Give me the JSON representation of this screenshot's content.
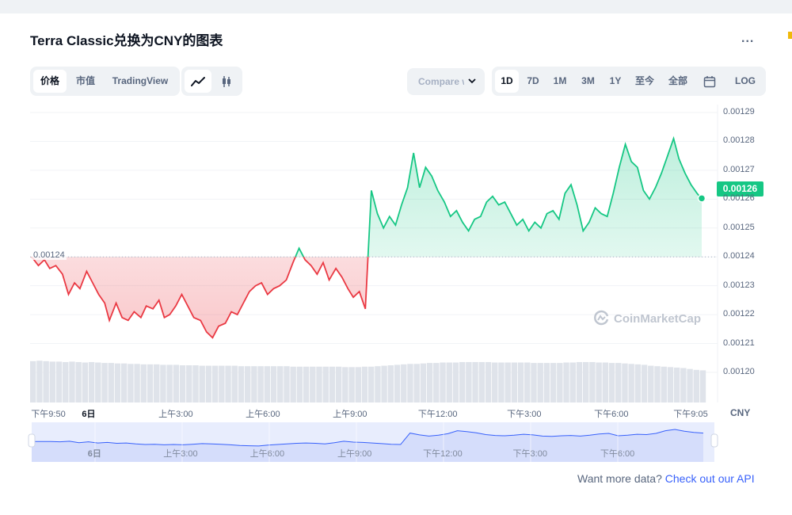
{
  "title": "Terra Classic兑换为CNY的图表",
  "more_label": "...",
  "view_tabs": [
    {
      "label": "价格",
      "active": true
    },
    {
      "label": "市值",
      "active": false
    },
    {
      "label": "TradingView",
      "active": false
    }
  ],
  "chart_type_icons": [
    "line-chart-icon",
    "candlestick-icon"
  ],
  "compare_label": "Compare with",
  "range_tabs": [
    {
      "label": "1D",
      "active": true
    },
    {
      "label": "7D",
      "active": false
    },
    {
      "label": "1M",
      "active": false
    },
    {
      "label": "3M",
      "active": false
    },
    {
      "label": "1Y",
      "active": false
    },
    {
      "label": "至今",
      "active": false
    },
    {
      "label": "全部",
      "active": false
    }
  ],
  "calendar_icon": "calendar-icon",
  "log_label": "LOG",
  "currency": "CNY",
  "watermark": "CoinMarketCap",
  "footer": {
    "text": "Want more data? ",
    "link": "Check out our API"
  },
  "colors": {
    "up": "#16c784",
    "down": "#ea3943",
    "accent": "#3861fb"
  },
  "chart_data": {
    "type": "line",
    "reference_value": 0.00124,
    "reference_label": "0.00124",
    "current_value": 0.00126,
    "current_label": "0.00126",
    "y_ticks": [
      "0.00129",
      "0.00128",
      "0.00127",
      "0.00126",
      "0.00125",
      "0.00124",
      "0.00123",
      "0.00122",
      "0.00121",
      "0.00120"
    ],
    "ylim": [
      0.001195,
      0.00129
    ],
    "x_ticks": [
      {
        "label": "下午9:50",
        "pos": 0.0,
        "bold": false
      },
      {
        "label": "6日",
        "pos": 0.085,
        "bold": true
      },
      {
        "label": "上午3:00",
        "pos": 0.215,
        "bold": false
      },
      {
        "label": "上午6:00",
        "pos": 0.345,
        "bold": false
      },
      {
        "label": "上午9:00",
        "pos": 0.475,
        "bold": false
      },
      {
        "label": "下午12:00",
        "pos": 0.606,
        "bold": false
      },
      {
        "label": "下午3:00",
        "pos": 0.735,
        "bold": false
      },
      {
        "label": "下午6:00",
        "pos": 0.865,
        "bold": false
      },
      {
        "label": "下午9:05",
        "pos": 0.985,
        "bold": false
      }
    ],
    "nav_ticks": [
      {
        "label": "6日",
        "pos": 0.092,
        "bold": true
      },
      {
        "label": "上午3:00",
        "pos": 0.218,
        "bold": false
      },
      {
        "label": "上午6:00",
        "pos": 0.345,
        "bold": false
      },
      {
        "label": "上午9:00",
        "pos": 0.473,
        "bold": false
      },
      {
        "label": "下午12:00",
        "pos": 0.602,
        "bold": false
      },
      {
        "label": "下午3:00",
        "pos": 0.73,
        "bold": false
      },
      {
        "label": "下午6:00",
        "pos": 0.858,
        "bold": false
      }
    ],
    "series": [
      {
        "x": [
          0.0,
          0.01,
          0.019,
          0.027,
          0.036,
          0.046,
          0.055,
          0.064,
          0.072,
          0.082,
          0.091,
          0.1,
          0.109,
          0.116,
          0.126,
          0.135,
          0.144,
          0.153,
          0.163,
          0.171,
          0.181,
          0.19,
          0.198,
          0.206,
          0.215,
          0.224,
          0.233,
          0.242,
          0.252,
          0.261,
          0.27,
          0.279,
          0.289,
          0.298,
          0.307,
          0.316,
          0.325,
          0.334,
          0.343,
          0.352,
          0.361,
          0.37,
          0.38,
          0.39,
          0.399,
          0.408,
          0.417,
          0.426,
          0.435,
          0.444,
          0.454,
          0.463,
          0.472,
          0.48,
          0.489,
          0.498,
          0.507,
          0.516,
          0.525,
          0.534,
          0.543,
          0.552,
          0.561,
          0.57,
          0.579,
          0.588,
          0.597,
          0.606,
          0.616,
          0.625,
          0.634,
          0.643,
          0.652,
          0.661,
          0.67,
          0.679,
          0.688,
          0.697,
          0.706,
          0.715,
          0.724,
          0.733,
          0.742,
          0.751,
          0.76,
          0.769,
          0.778,
          0.787,
          0.796,
          0.805,
          0.814,
          0.823,
          0.832,
          0.841,
          0.85,
          0.859,
          0.868,
          0.877,
          0.886,
          0.895,
          0.904,
          0.913,
          0.922,
          0.931,
          0.94,
          0.949,
          0.958,
          0.966,
          0.975,
          0.984,
          0.993,
          1.0
        ],
        "y": [
          0.00124,
          0.001237,
          0.001239,
          0.001236,
          0.001237,
          0.001234,
          0.001227,
          0.001231,
          0.001229,
          0.001235,
          0.001231,
          0.001227,
          0.001224,
          0.001218,
          0.001224,
          0.001219,
          0.001218,
          0.001221,
          0.001219,
          0.001223,
          0.001222,
          0.001225,
          0.001219,
          0.00122,
          0.001223,
          0.001227,
          0.001223,
          0.001219,
          0.001218,
          0.001214,
          0.001212,
          0.001216,
          0.001217,
          0.001221,
          0.00122,
          0.001224,
          0.001228,
          0.00123,
          0.001231,
          0.001227,
          0.001229,
          0.00123,
          0.001232,
          0.001238,
          0.001243,
          0.001239,
          0.001237,
          0.001234,
          0.001238,
          0.001232,
          0.001236,
          0.001233,
          0.001229,
          0.001226,
          0.001228,
          0.001222,
          0.001263,
          0.001255,
          0.00125,
          0.001254,
          0.001251,
          0.001258,
          0.001264,
          0.001276,
          0.001264,
          0.001271,
          0.001268,
          0.001263,
          0.001259,
          0.001254,
          0.001256,
          0.001252,
          0.001249,
          0.001253,
          0.001254,
          0.001259,
          0.001261,
          0.001258,
          0.001259,
          0.001255,
          0.001251,
          0.001253,
          0.001249,
          0.001252,
          0.00125,
          0.001255,
          0.001256,
          0.001253,
          0.001262,
          0.001265,
          0.001258,
          0.001249,
          0.001252,
          0.001257,
          0.001255,
          0.001254,
          0.001262,
          0.001271,
          0.001279,
          0.001273,
          0.001271,
          0.001263,
          0.00126,
          0.001264,
          0.001269,
          0.001275,
          0.001281,
          0.001274,
          0.001269,
          0.001265,
          0.001262,
          0.00126
        ]
      }
    ],
    "volume": [
      0.9,
      0.91,
      0.9,
      0.89,
      0.89,
      0.88,
      0.89,
      0.88,
      0.87,
      0.88,
      0.87,
      0.86,
      0.86,
      0.85,
      0.85,
      0.84,
      0.84,
      0.83,
      0.83,
      0.83,
      0.82,
      0.82,
      0.82,
      0.81,
      0.81,
      0.81,
      0.8,
      0.8,
      0.8,
      0.8,
      0.8,
      0.8,
      0.79,
      0.79,
      0.79,
      0.79,
      0.79,
      0.79,
      0.79,
      0.79,
      0.78,
      0.78,
      0.78,
      0.78,
      0.78,
      0.78,
      0.78,
      0.78,
      0.77,
      0.77,
      0.77,
      0.78,
      0.78,
      0.79,
      0.8,
      0.81,
      0.82,
      0.83,
      0.84,
      0.84,
      0.85,
      0.86,
      0.86,
      0.87,
      0.87,
      0.87,
      0.88,
      0.88,
      0.88,
      0.88,
      0.88,
      0.87,
      0.87,
      0.87,
      0.87,
      0.87,
      0.87,
      0.86,
      0.86,
      0.86,
      0.86,
      0.86,
      0.87,
      0.87,
      0.88,
      0.88,
      0.88,
      0.87,
      0.87,
      0.86,
      0.86,
      0.85,
      0.84,
      0.83,
      0.82,
      0.8,
      0.79,
      0.78,
      0.77,
      0.76,
      0.75,
      0.73,
      0.71,
      0.7
    ],
    "nav_series": [
      0.52,
      0.52,
      0.52,
      0.51,
      0.53,
      0.48,
      0.51,
      0.47,
      0.49,
      0.46,
      0.47,
      0.44,
      0.42,
      0.43,
      0.41,
      0.42,
      0.41,
      0.43,
      0.45,
      0.44,
      0.43,
      0.41,
      0.39,
      0.38,
      0.37,
      0.4,
      0.42,
      0.44,
      0.46,
      0.47,
      0.46,
      0.44,
      0.48,
      0.53,
      0.5,
      0.49,
      0.47,
      0.45,
      0.43,
      0.42,
      0.8,
      0.74,
      0.7,
      0.73,
      0.78,
      0.88,
      0.85,
      0.81,
      0.75,
      0.72,
      0.71,
      0.73,
      0.76,
      0.74,
      0.7,
      0.69,
      0.71,
      0.72,
      0.7,
      0.73,
      0.77,
      0.79,
      0.71,
      0.73,
      0.76,
      0.75,
      0.79,
      0.88,
      0.92,
      0.86,
      0.82,
      0.8
    ]
  }
}
